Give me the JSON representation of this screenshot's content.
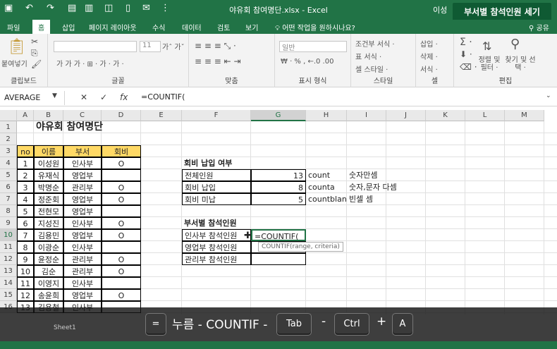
{
  "titlebar": {
    "doc_title": "야유회 참여명단.xlsx  -  Excel",
    "user": "이성",
    "banner": "부서별 참석인원 세기"
  },
  "tabs": {
    "file": "파일",
    "home": "홈",
    "insert": "삽입",
    "layout": "페이지 레이아웃",
    "formulas": "수식",
    "data": "데이터",
    "review": "검토",
    "view": "보기",
    "tellme": "어떤 작업을 원하시나요?",
    "share": "공유"
  },
  "ribbon": {
    "paste": "붙여넣기",
    "clipboard": "클립보드",
    "font": "글꼴",
    "font_size": "11",
    "font_row2": "가  가  가 ·  ⊞ ·  가 ·  가 ·",
    "alignment": "맞춤",
    "number_format": "일반",
    "number_row2": "₩ · %  ,  ←.0  .00",
    "number": "표시 형식",
    "cond_format": "조건부 서식 ·",
    "table_format": "표 서식 ·",
    "cell_styles": "셀 스타일 ·",
    "styles": "스타일",
    "insert": "삽입 ·",
    "delete": "삭제 ·",
    "format": "서식 ·",
    "cells": "셀",
    "sort": "정렬 및 필터 ·",
    "find": "찾기 및 선택 ·",
    "editing": "편집"
  },
  "formula_bar": {
    "name_box": "AVERAGE",
    "cancel": "✕",
    "enter": "✓",
    "fx": "fx",
    "formula": "=COUNTIF("
  },
  "columns": [
    "A",
    "B",
    "C",
    "D",
    "E",
    "F",
    "G",
    "H",
    "I",
    "J",
    "K",
    "L",
    "M"
  ],
  "rows": [
    "1",
    "2",
    "3",
    "4",
    "5",
    "6",
    "7",
    "8",
    "9",
    "10",
    "11",
    "12",
    "13",
    "14",
    "15",
    "16"
  ],
  "sheet": {
    "title": "야유회 참여명단",
    "headers": [
      "no",
      "이름",
      "부서",
      "회비"
    ],
    "members": [
      {
        "no": "1",
        "name": "이성원",
        "dept": "인사부",
        "fee": "O"
      },
      {
        "no": "2",
        "name": "유재식",
        "dept": "영업부",
        "fee": ""
      },
      {
        "no": "3",
        "name": "박명순",
        "dept": "관리부",
        "fee": "O"
      },
      {
        "no": "4",
        "name": "정준회",
        "dept": "영업부",
        "fee": "O"
      },
      {
        "no": "5",
        "name": "전현모",
        "dept": "영업부",
        "fee": ""
      },
      {
        "no": "6",
        "name": "지성진",
        "dept": "인사부",
        "fee": "O"
      },
      {
        "no": "7",
        "name": "김용민",
        "dept": "영업부",
        "fee": "O"
      },
      {
        "no": "8",
        "name": "이광순",
        "dept": "인사부",
        "fee": ""
      },
      {
        "no": "9",
        "name": "윤정순",
        "dept": "관리부",
        "fee": "O"
      },
      {
        "no": "10",
        "name": "김순",
        "dept": "관리부",
        "fee": "O"
      },
      {
        "no": "11",
        "name": "이영지",
        "dept": "인사부",
        "fee": ""
      },
      {
        "no": "12",
        "name": "송윤희",
        "dept": "영업부",
        "fee": "O"
      },
      {
        "no": "13",
        "name": "김용철",
        "dept": "인사부",
        "fee": ""
      }
    ],
    "fee_section": {
      "title": "회비 납입 여부",
      "rows": [
        {
          "label": "전체인원",
          "value": "13",
          "fn": "count",
          "desc": "숫자만셈"
        },
        {
          "label": "회비 납입",
          "value": "8",
          "fn": "counta",
          "desc": "숫자,문자 다셈"
        },
        {
          "label": "회비 미납",
          "value": "5",
          "fn": "countblank",
          "desc": "빈셀 셈"
        }
      ]
    },
    "dept_section": {
      "title": "부서별 참석인원",
      "rows": [
        {
          "label": "인사부 참석인원",
          "value": "=COUNTIF("
        },
        {
          "label": "영업부 참석인원",
          "value": ""
        },
        {
          "label": "관리부 참석인원",
          "value": ""
        }
      ],
      "hint": "COUNTIF(range, criteria)"
    }
  },
  "overlay": {
    "key1": "=",
    "text1": "누름 - COUNTIF -",
    "key2": "Tab",
    "sep": "-",
    "key3": "Ctrl",
    "plus": "+",
    "key4": "A"
  },
  "sheet_tab": "Sheet1"
}
